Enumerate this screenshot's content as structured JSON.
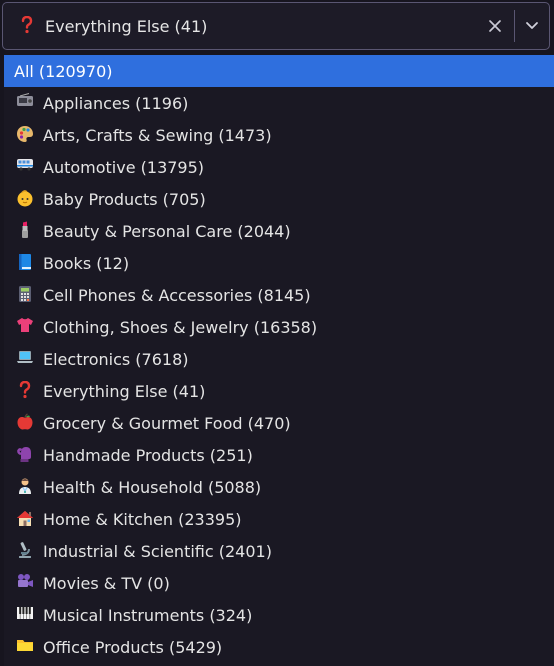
{
  "select": {
    "value": "Everything Else (41)",
    "value_icon": "question-icon"
  },
  "colors": {
    "selected_bg": "#2f6fde",
    "background": "#1a1823"
  },
  "options": [
    {
      "label": "All (120970)",
      "icon": "",
      "selected": true
    },
    {
      "label": "Appliances (1196)",
      "icon": "radio-icon"
    },
    {
      "label": "Arts, Crafts & Sewing (1473)",
      "icon": "palette-icon"
    },
    {
      "label": "Automotive (13795)",
      "icon": "bus-icon"
    },
    {
      "label": "Baby Products (705)",
      "icon": "baby-icon"
    },
    {
      "label": "Beauty & Personal Care (2044)",
      "icon": "lipstick-icon"
    },
    {
      "label": "Books (12)",
      "icon": "book-icon"
    },
    {
      "label": "Cell Phones & Accessories (8145)",
      "icon": "calculator-icon"
    },
    {
      "label": "Clothing, Shoes & Jewelry (16358)",
      "icon": "tshirt-icon"
    },
    {
      "label": "Electronics (7618)",
      "icon": "laptop-icon"
    },
    {
      "label": "Everything Else (41)",
      "icon": "question-icon"
    },
    {
      "label": "Grocery & Gourmet Food (470)",
      "icon": "apple-icon"
    },
    {
      "label": "Handmade Products (251)",
      "icon": "mitten-icon"
    },
    {
      "label": "Health & Household (5088)",
      "icon": "health-worker-icon"
    },
    {
      "label": "Home & Kitchen (23395)",
      "icon": "house-icon"
    },
    {
      "label": "Industrial & Scientific (2401)",
      "icon": "microscope-icon"
    },
    {
      "label": "Movies & TV (0)",
      "icon": "movie-camera-icon"
    },
    {
      "label": "Musical Instruments (324)",
      "icon": "piano-icon"
    },
    {
      "label": "Office Products (5429)",
      "icon": "folder-icon"
    }
  ]
}
